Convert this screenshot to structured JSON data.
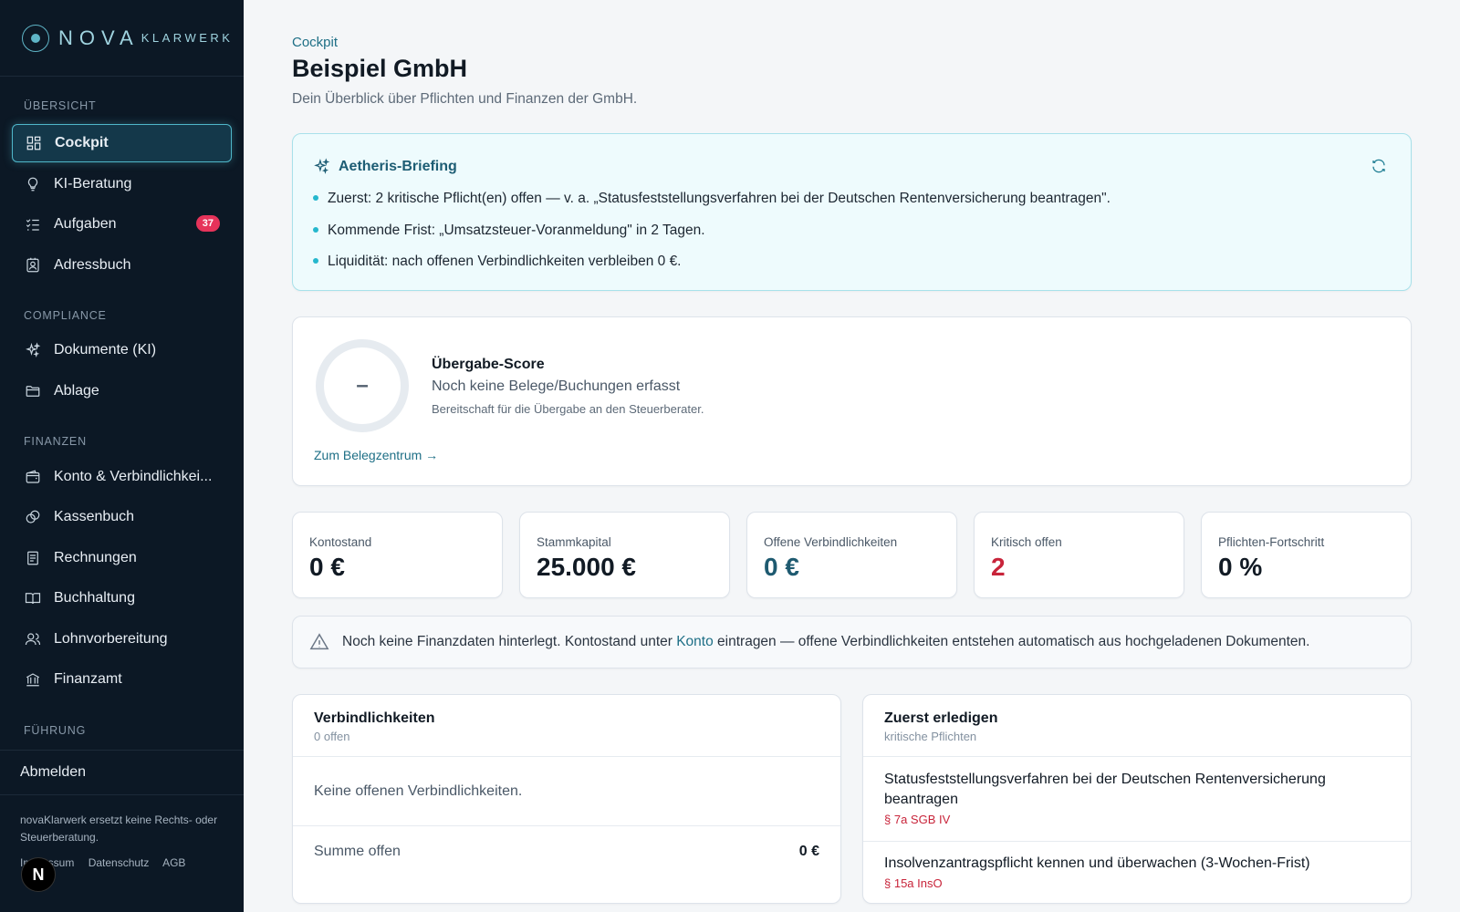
{
  "brand": {
    "name": "NOVA",
    "suffix": "KLARWERK"
  },
  "sidebar": {
    "sections": [
      {
        "label": "ÜBERSICHT"
      },
      {
        "label": "COMPLIANCE"
      },
      {
        "label": "FINANZEN"
      },
      {
        "label": "FÜHRUNG"
      }
    ],
    "items": [
      {
        "label": "Cockpit",
        "icon": "grid-icon",
        "active": true
      },
      {
        "label": "KI-Beratung",
        "icon": "lightbulb-icon"
      },
      {
        "label": "Aufgaben",
        "icon": "checklist-icon",
        "badge": "37"
      },
      {
        "label": "Adressbuch",
        "icon": "contact-book-icon"
      },
      {
        "label": "Dokumente (KI)",
        "icon": "sparkles-icon"
      },
      {
        "label": "Ablage",
        "icon": "folder-icon"
      },
      {
        "label": "Konto & Verbindlichkei...",
        "icon": "wallet-icon"
      },
      {
        "label": "Kassenbuch",
        "icon": "coins-icon"
      },
      {
        "label": "Rechnungen",
        "icon": "receipt-icon"
      },
      {
        "label": "Buchhaltung",
        "icon": "book-icon"
      },
      {
        "label": "Lohnvorbereitung",
        "icon": "users-icon"
      },
      {
        "label": "Finanzamt",
        "icon": "bank-icon"
      }
    ],
    "logout_label": "Abmelden",
    "disclaimer": "novaKlarwerk ersetzt keine Rechts- oder Steuerberatung.",
    "footer_links": [
      "Impressum",
      "Datenschutz",
      "AGB"
    ],
    "avatar_letter": "N"
  },
  "header": {
    "breadcrumb": "Cockpit",
    "title": "Beispiel GmbH",
    "subtitle": "Dein Überblick über Pflichten und Finanzen der GmbH."
  },
  "briefing": {
    "title": "Aetheris-Briefing",
    "bullets": [
      "Zuerst: 2 kritische Pflicht(en) offen — v. a. „Statusfeststellungsverfahren bei der Deutschen Rentenversicherung beantragen\".",
      "Kommende Frist: „Umsatzsteuer-Voranmeldung\" in 2 Tagen.",
      "Liquidität: nach offenen Verbindlichkeiten verbleiben 0 €."
    ]
  },
  "score": {
    "ring_value": "–",
    "title": "Übergabe-Score",
    "subtitle": "Noch keine Belege/Buchungen erfasst",
    "description": "Bereitschaft für die Übergabe an den Steuerberater.",
    "link": "Zum Belegzentrum →"
  },
  "kpis": [
    {
      "label": "Kontostand",
      "value": "0 €",
      "color": "#111a24"
    },
    {
      "label": "Stammkapital",
      "value": "25.000 €",
      "color": "#111a24"
    },
    {
      "label": "Offene Verbindlichkeiten",
      "value": "0 €",
      "color": "#1e5a70"
    },
    {
      "label": "Kritisch offen",
      "value": "2",
      "color": "#c8243a"
    },
    {
      "label": "Pflichten-Fortschritt",
      "value": "0 %",
      "color": "#111a24"
    }
  ],
  "notice": {
    "text_before": "Noch keine Finanzdaten hinterlegt. Kontostand unter ",
    "link": "Konto",
    "text_after": " eintragen — offene Verbindlichkeiten entstehen automatisch aus hochgeladenen Dokumenten."
  },
  "liabilities": {
    "title": "Verbindlichkeiten",
    "subtitle": "0 offen",
    "empty": "Keine offenen Verbindlichkeiten.",
    "sum_label": "Summe offen",
    "sum_value": "0 €"
  },
  "first_tasks": {
    "title": "Zuerst erledigen",
    "subtitle": "kritische Pflichten",
    "items": [
      {
        "title": "Statusfeststellungsverfahren bei der Deutschen Rentenversicherung beantragen",
        "ref": "§ 7a SGB IV"
      },
      {
        "title": "Insolvenzantragspflicht kennen und überwachen (3-Wochen-Frist)",
        "ref": "§ 15a InsO"
      }
    ]
  }
}
